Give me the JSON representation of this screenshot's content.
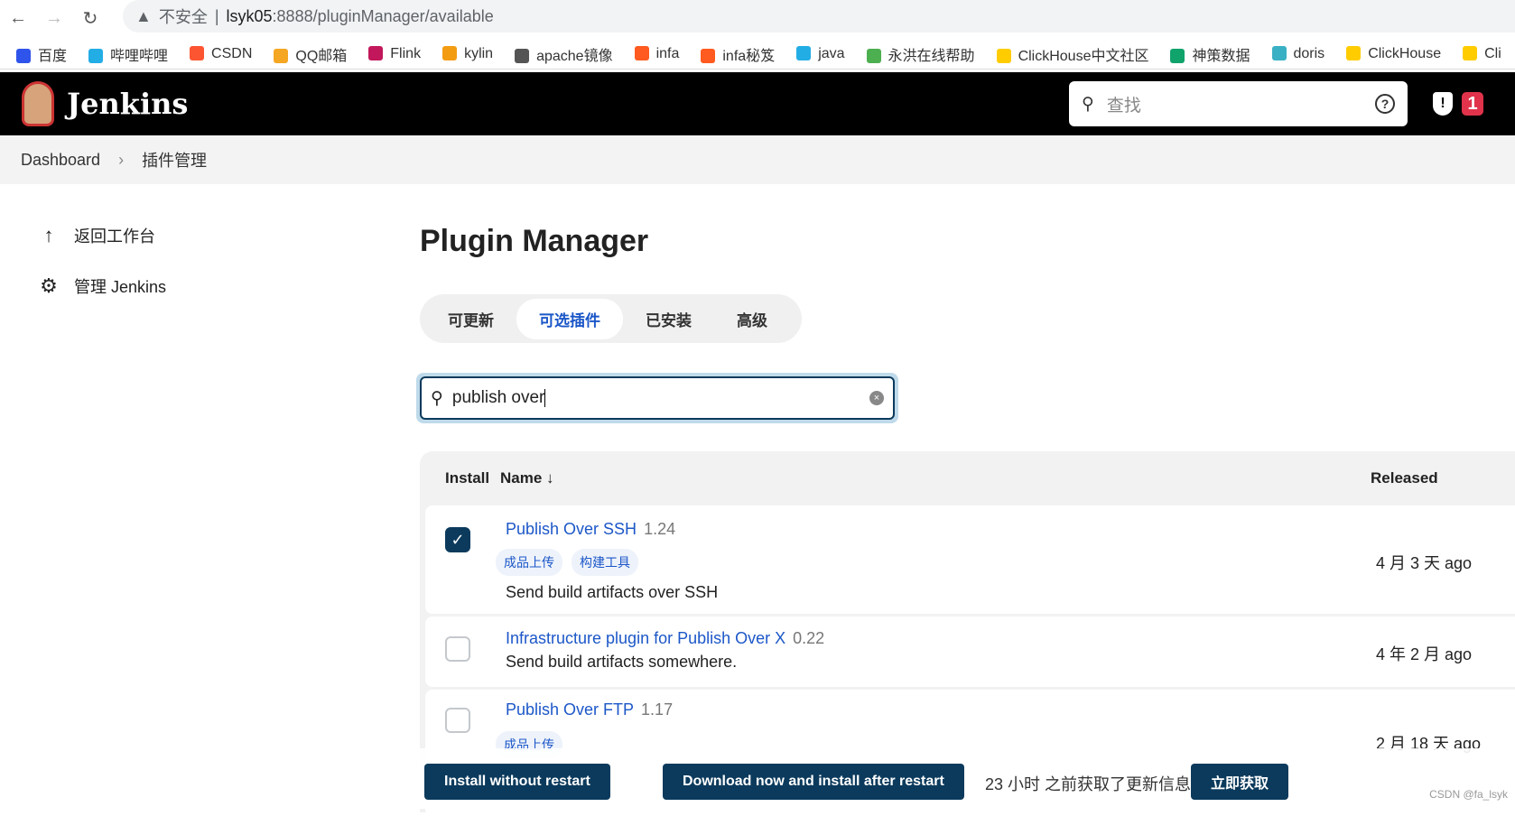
{
  "browser": {
    "security_label": "不安全",
    "url_host": "lsyk05",
    "url_rest": ":8888/pluginManager/available",
    "bookmarks": [
      {
        "label": "百度",
        "color": "#2f54eb"
      },
      {
        "label": "哔哩哔哩",
        "color": "#23ade5"
      },
      {
        "label": "CSDN",
        "color": "#fc5531"
      },
      {
        "label": "QQ邮箱",
        "color": "#f5a623"
      },
      {
        "label": "Flink",
        "color": "#c2185b"
      },
      {
        "label": "kylin",
        "color": "#f39c12"
      },
      {
        "label": "apache镜像",
        "color": "#555555"
      },
      {
        "label": "infa",
        "color": "#ff5a1f"
      },
      {
        "label": "infa秘笈",
        "color": "#ff5a1f"
      },
      {
        "label": "java",
        "color": "#23ade5"
      },
      {
        "label": "永洪在线帮助",
        "color": "#4caf50"
      },
      {
        "label": "ClickHouse中文社区",
        "color": "#ffcc00"
      },
      {
        "label": "神策数据",
        "color": "#10a36b"
      },
      {
        "label": "doris",
        "color": "#3ab0c4"
      },
      {
        "label": "ClickHouse",
        "color": "#ffcc00"
      },
      {
        "label": "Cli",
        "color": "#ffcc00"
      }
    ]
  },
  "header": {
    "brand": "Jenkins",
    "search_placeholder": "查找",
    "help": "?",
    "security_badge": "1"
  },
  "breadcrumb": [
    "Dashboard",
    "插件管理"
  ],
  "sidebar": [
    {
      "label": "返回工作台",
      "icon": "arrow-up-icon"
    },
    {
      "label": "管理 Jenkins",
      "icon": "gear-icon"
    }
  ],
  "main": {
    "title": "Plugin Manager",
    "tabs": [
      {
        "label": "可更新"
      },
      {
        "label": "可选插件",
        "active": true
      },
      {
        "label": "已安装"
      },
      {
        "label": "高级"
      }
    ],
    "search_value": "publish over",
    "columns": {
      "install": "Install",
      "name": "Name ↓",
      "released": "Released"
    },
    "plugins": [
      {
        "name": "Publish Over SSH",
        "version": "1.24",
        "tags": [
          "成品上传",
          "构建工具"
        ],
        "description": "Send build artifacts over SSH",
        "released": "4 月 3 天 ago",
        "checked": true
      },
      {
        "name": "Infrastructure plugin for Publish Over X",
        "version": "0.22",
        "tags": [],
        "description": "Send build artifacts somewhere.",
        "released": "4 年 2 月 ago",
        "checked": false
      },
      {
        "name": "Publish Over FTP",
        "version": "1.17",
        "tags": [
          "成品上传"
        ],
        "description": "",
        "released": "2 月 18 天 ago",
        "checked": false
      }
    ]
  },
  "footer": {
    "install_without_restart": "Install without restart",
    "download_install_after_restart": "Download now and install after restart",
    "update_info": "23 小时 之前获取了更新信息",
    "fetch_now": "立即获取",
    "watermark": "CSDN @fa_lsyk"
  },
  "colors": {
    "accent": "#0b3a5c",
    "link": "#1c57c8",
    "badge": "#e0334b"
  }
}
